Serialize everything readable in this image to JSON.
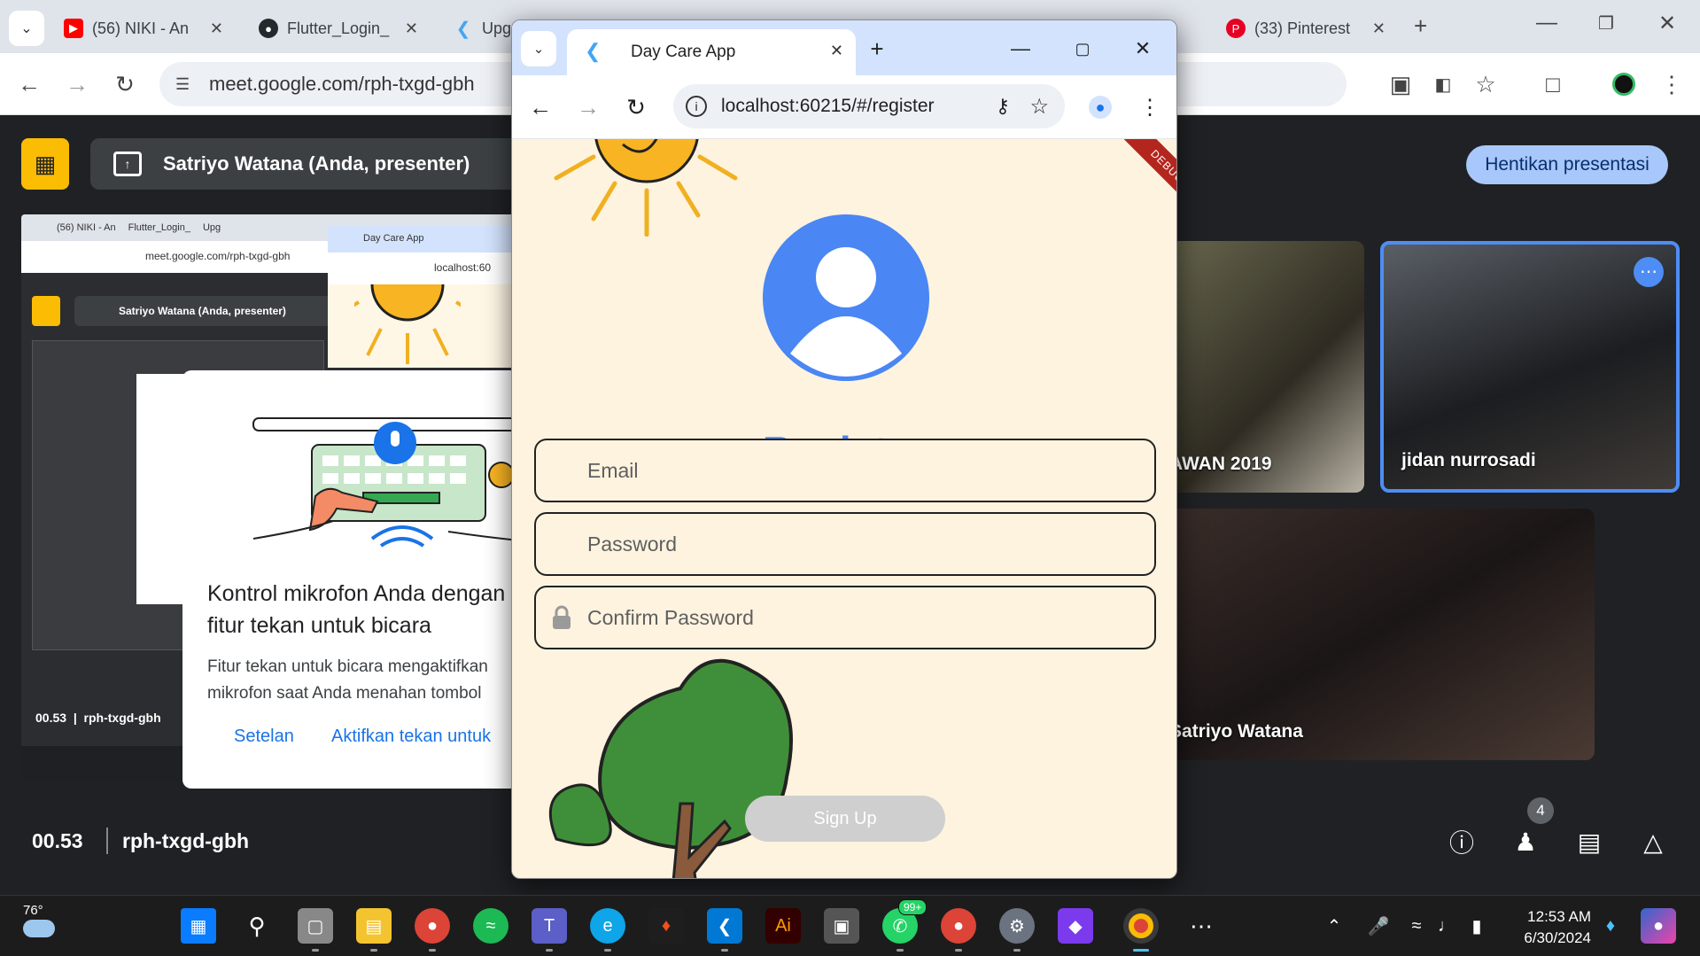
{
  "outer_browser": {
    "tabs": [
      {
        "title": "(56) NIKI - An",
        "icon": "youtube-icon",
        "color": "#ff0000"
      },
      {
        "title": "Flutter_Login_",
        "icon": "github-icon",
        "color": "#24292e"
      },
      {
        "title": "Upg",
        "icon": "flutter-icon",
        "color": "#42a5f5"
      },
      {
        "title": "(33) Pinterest",
        "icon": "pinterest-icon",
        "color": "#e60023"
      }
    ],
    "url": "meet.google.com/rph-txgd-gbh"
  },
  "meet": {
    "presenter_label": "Satriyo Watana (Anda, presenter)",
    "stop_button": "Hentikan presentasi",
    "meeting_time": "00.53",
    "meeting_code": "rph-txgd-gbh",
    "participant_count": "4",
    "tiles": [
      {
        "name": "AWAN 2019"
      },
      {
        "name": "jidan nurrosadi"
      },
      {
        "name": "Satriyo Watana"
      }
    ]
  },
  "thumbnail": {
    "tabs": [
      "(56) NIKI - An",
      "Flutter_Login_",
      "Upg"
    ],
    "url": "meet.google.com/rph-txgd-gbh",
    "presenter_label": "Satriyo Watana (Anda, presenter)",
    "inner_app_tab": "Day Care App",
    "inner_app_url": "localhost:60",
    "footer_time": "00.53",
    "footer_code": "rph-txgd-gbh"
  },
  "mic_popup": {
    "title": "Kontrol mikrofon Anda dengan fitur tekan untuk bicara",
    "body": "Fitur tekan untuk bicara mengaktifkan mikrofon saat Anda menahan tombol",
    "settings_link": "Setelan",
    "enable_link": "Aktifkan tekan untuk"
  },
  "app_window": {
    "tab_title": "Day Care App",
    "url": "localhost:60215/#/register",
    "debug_banner": "DEBUG",
    "heading": "Register",
    "fields": [
      {
        "placeholder": "Email"
      },
      {
        "placeholder": "Password"
      },
      {
        "placeholder": "Confirm Password"
      }
    ],
    "submit_label": "Sign Up",
    "accent": "#4a86f4",
    "background": "#fdf3df"
  },
  "taskbar": {
    "weather_temp": "76°",
    "whatsapp_badge": "99+",
    "time": "12:53 AM",
    "date": "6/30/2024"
  }
}
